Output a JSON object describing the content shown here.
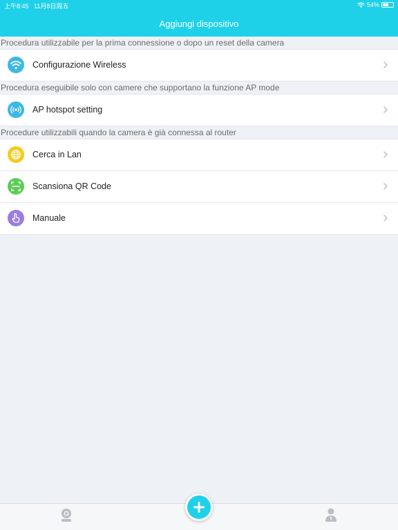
{
  "status_bar": {
    "time": "上午8:45",
    "date": "11月8日周五",
    "battery": "54%",
    "battery_level": 0.54
  },
  "header": {
    "title": "Aggiungi dispositivo"
  },
  "sections": [
    {
      "label": "Procedura utilizzabile per la prima connessione o dopo un reset della camera",
      "items": [
        {
          "label": "Configurazione Wireless",
          "icon": "wifi-icon",
          "color": "#3bb8e8"
        }
      ]
    },
    {
      "label": "Procedura eseguibile solo con camere che supportano la funzione AP mode",
      "items": [
        {
          "label": "AP hotspot setting",
          "icon": "hotspot-icon",
          "color": "#3bb8e8"
        }
      ]
    },
    {
      "label": "Procedure utilizzabili quando la camera è già connessa al router",
      "items": [
        {
          "label": "Cerca in Lan",
          "icon": "globe-icon",
          "color": "#f5cc1a"
        },
        {
          "label": "Scansiona QR Code",
          "icon": "qr-scan-icon",
          "color": "#5ccc55"
        },
        {
          "label": "Manuale",
          "icon": "hand-pointer-icon",
          "color": "#9a7de3"
        }
      ]
    }
  ],
  "tab_bar": {
    "left_icon": "camera-icon",
    "center_icon": "add-icon",
    "right_icon": "user-icon"
  }
}
